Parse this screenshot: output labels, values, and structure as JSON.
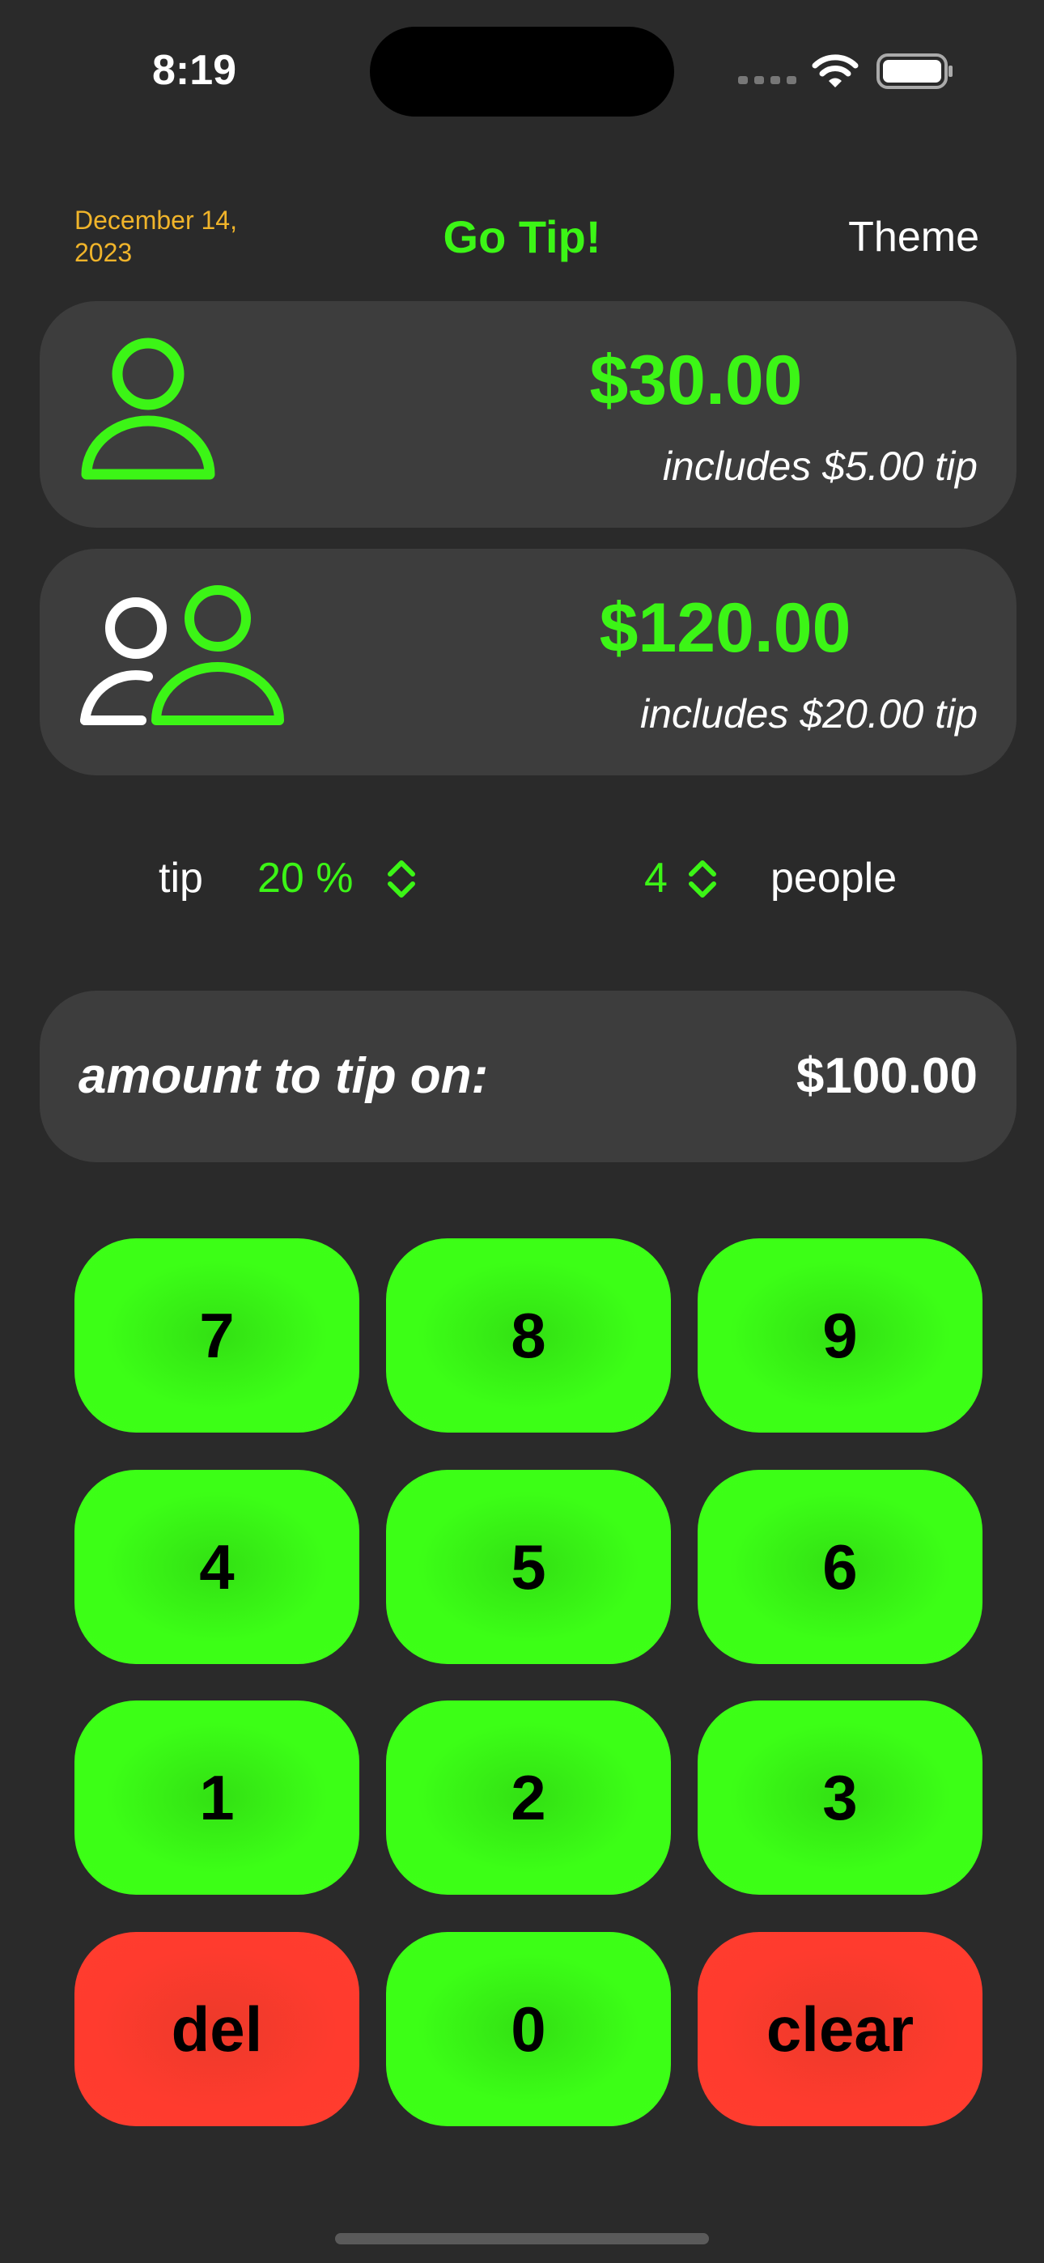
{
  "status_bar": {
    "time": "8:19"
  },
  "header": {
    "date": "December 14, 2023",
    "title": "Go Tip!",
    "theme_label": "Theme"
  },
  "per_person": {
    "icon": "person-icon",
    "amount": "$30.00",
    "tip_note": "includes $5.00 tip"
  },
  "total": {
    "icon": "two-people-icon",
    "amount": "$120.00",
    "tip_note": "includes $20.00 tip"
  },
  "controls": {
    "tip_label": "tip",
    "tip_value": "20 %",
    "people_value": "4",
    "people_label": "people"
  },
  "amount_card": {
    "label": "amount to tip on:",
    "value": "$100.00"
  },
  "keypad": {
    "keys": [
      "7",
      "8",
      "9",
      "4",
      "5",
      "6",
      "1",
      "2",
      "3",
      "del",
      "0",
      "clear"
    ]
  },
  "colors": {
    "accent_green": "#3cf516",
    "date_yellow": "#f0b42a",
    "danger_red": "#ff3b2e",
    "background": "#2a2a2a",
    "card": "#3d3d3d"
  }
}
